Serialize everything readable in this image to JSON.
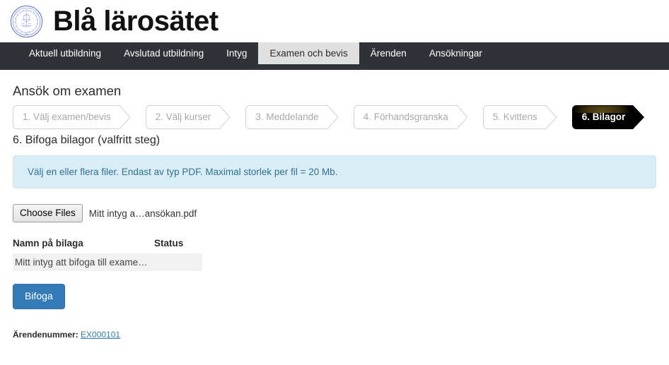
{
  "header": {
    "title": "Blå lärosätet",
    "logo_alt": "university-seal",
    "seal_color": "#5b73d4"
  },
  "nav": {
    "tabs": [
      {
        "label": "Aktuell utbildning",
        "active": false
      },
      {
        "label": "Avslutad utbildning",
        "active": false
      },
      {
        "label": "Intyg",
        "active": false
      },
      {
        "label": "Examen och bevis",
        "active": true
      },
      {
        "label": "Ärenden",
        "active": false
      },
      {
        "label": "Ansökningar",
        "active": false
      }
    ],
    "bar_color": "#2f3337",
    "active_tab_color": "#e0e0e0"
  },
  "main": {
    "page_heading": "Ansök om examen",
    "steps": [
      {
        "label": "1. Välj examen/bevis",
        "active": false
      },
      {
        "label": "2. Välj kurser",
        "active": false
      },
      {
        "label": "3. Meddelande",
        "active": false
      },
      {
        "label": "4. Förhandsgranska",
        "active": false
      },
      {
        "label": "5. Kvittens",
        "active": false
      },
      {
        "label": "6. Bilagor",
        "active": true
      }
    ],
    "sub_heading": "6. Bifoga bilagor (valfritt steg)",
    "info_alert": "Välj en eller flera filer. Endast av typ PDF. Maximal storlek per fil = 20 Mb.",
    "file_picker": {
      "button_label": "Choose Files",
      "selected_file": "Mitt intyg a…ansökan.pdf"
    },
    "table": {
      "columns": [
        "Namn på bilaga",
        "Status"
      ],
      "rows": [
        {
          "name": "Mitt intyg att bifoga till exame…",
          "status": ""
        }
      ]
    },
    "submit_button": "Bifoga",
    "case": {
      "label": "Ärendenummer:",
      "number": "EX000101"
    }
  },
  "colors": {
    "primary": "#337ab7",
    "info_bg": "#d9edf7",
    "info_text": "#31708f",
    "navbar": "#2f3337",
    "active_step": "#000000"
  }
}
